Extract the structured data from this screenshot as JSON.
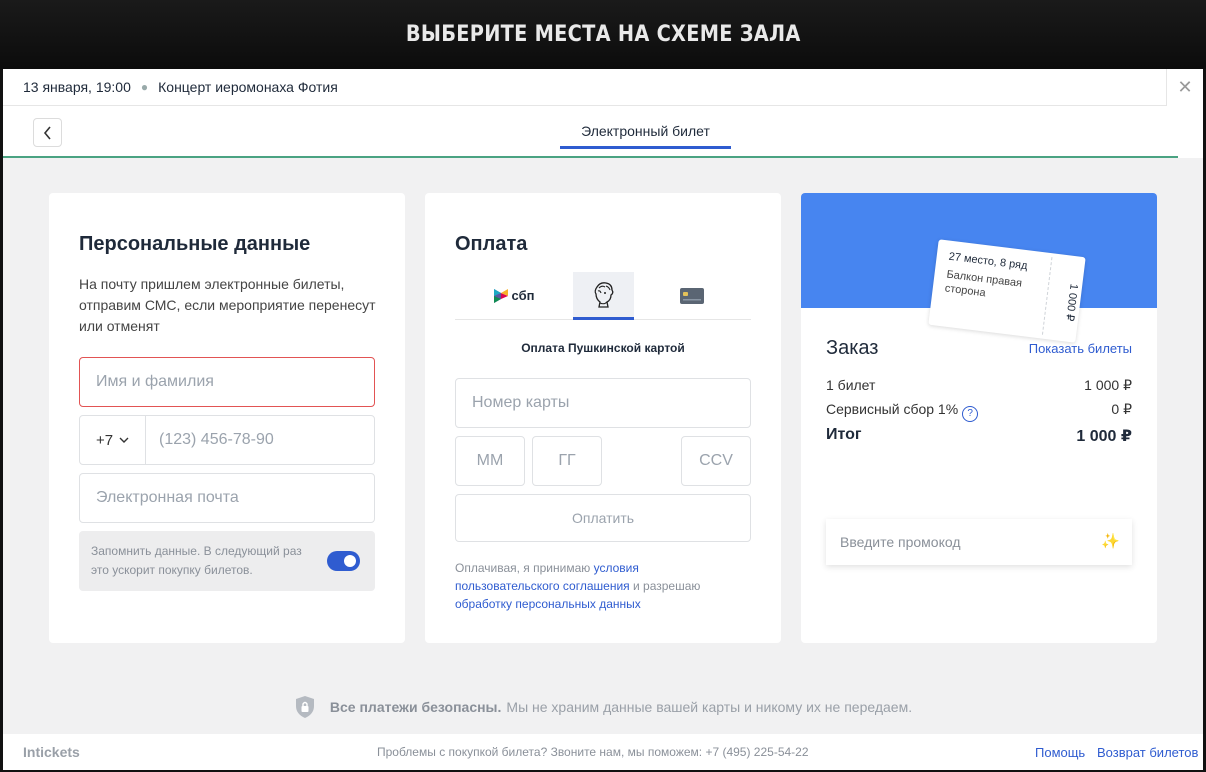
{
  "banner": {
    "title": "ВЫБЕРИТЕ МЕСТА НА СХЕМЕ ЗАЛА"
  },
  "event": {
    "date": "13 января, 19:00",
    "name": "Концерт иеромонаха Фотия"
  },
  "nav": {
    "tab_label": "Электронный билет"
  },
  "personal": {
    "title": "Персональные данные",
    "description": "На почту пришлем электронные билеты, отправим СМС, если мероприятие перенесут или отменят",
    "name_placeholder": "Имя и фамилия",
    "phone_code": "+7",
    "phone_placeholder": "(123) 456-78-90",
    "email_placeholder": "Электронная почта",
    "remember_text": "Запомнить данные. В следующий раз это ускорит покупку билетов.",
    "remember_on": true
  },
  "payment": {
    "title": "Оплата",
    "sbp_label": "сбп",
    "method_title": "Оплата Пушкинской картой",
    "card_number_placeholder": "Номер карты",
    "month_placeholder": "ММ",
    "year_placeholder": "ГГ",
    "ccv_placeholder": "CCV",
    "pay_button": "Оплатить",
    "terms_prefix": "Оплачивая, я принимаю ",
    "terms_link1": "условия пользовательского соглашения",
    "terms_middle": " и разрешаю ",
    "terms_link2": "обработку персональных данных"
  },
  "order": {
    "ticket_seat": "27 место, 8 ряд",
    "ticket_sector": "Балкон правая сторона",
    "ticket_price": "1 000 ₽",
    "title": "Заказ",
    "show_tickets": "Показать билеты",
    "tickets_label": "1 билет",
    "tickets_value": "1 000 ₽",
    "fee_label": "Сервисный сбор 1%",
    "fee_value": "0 ₽",
    "total_label": "Итог",
    "total_value": "1 000 ₽",
    "promo_placeholder": "Введите промокод"
  },
  "secure": {
    "bold": "Все платежи безопасны.",
    "text": "Мы не храним данные вашей карты и никому их не передаем."
  },
  "footer": {
    "brand": "Intickets",
    "help_text": "Проблемы с покупкой билета? Звоните нам, мы поможем: +7 (495) 225-54-22",
    "help_link": "Помощь",
    "refund_link": "Возврат билетов"
  },
  "colors": {
    "accent": "#2f5cd0",
    "order_hero": "#4785f0",
    "progress": "#4aa382",
    "error": "#e25353"
  }
}
